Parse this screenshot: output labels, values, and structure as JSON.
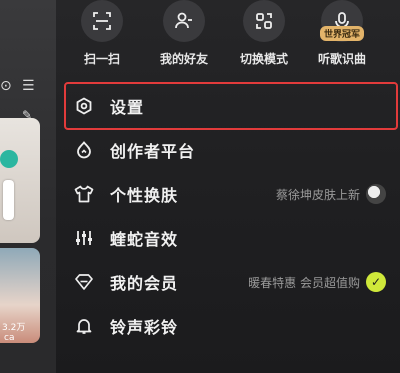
{
  "shortcuts": [
    {
      "label": "扫一扫",
      "icon": "scan-icon"
    },
    {
      "label": "我的好友",
      "icon": "friends-icon"
    },
    {
      "label": "切换模式",
      "icon": "switch-mode-icon"
    },
    {
      "label": "听歌识曲",
      "icon": "song-recognition-icon",
      "badge": "世界冠军"
    }
  ],
  "menu": [
    {
      "label": "设置",
      "icon": "settings-icon",
      "highlighted": true
    },
    {
      "label": "创作者平台",
      "icon": "creator-platform-icon"
    },
    {
      "label": "个性换肤",
      "icon": "skin-icon",
      "right_text": "蔡徐坤皮肤上新"
    },
    {
      "label": "蝰蛇音效",
      "icon": "sound-effect-icon"
    },
    {
      "label": "我的会员",
      "icon": "vip-icon",
      "right_text": "暖春特惠 会员超值购"
    },
    {
      "label": "铃声彩铃",
      "icon": "ringtone-icon"
    }
  ],
  "background": {
    "badge_count": "3.2万",
    "card_label": "ca"
  },
  "colors": {
    "highlight": "#e23b3b",
    "badge_gold": "#e3b46a"
  }
}
